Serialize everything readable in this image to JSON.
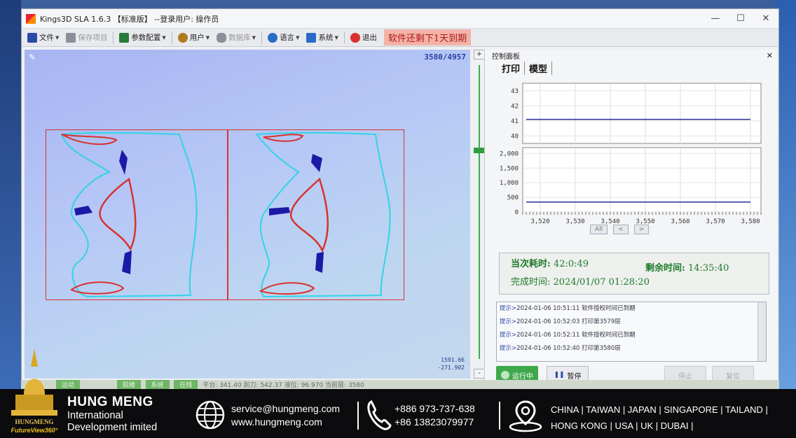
{
  "window": {
    "title": "Kings3D SLA 1.6.3 【标准版】 --登录用户: 操作员",
    "controls": [
      "—",
      "☐",
      "✕"
    ]
  },
  "toolbar": {
    "items": [
      {
        "label": "文件",
        "icon": "file-icon",
        "color": "#2a4ba8"
      },
      {
        "label": "保存项目",
        "icon": "save-icon",
        "color": "#8a8f99"
      },
      {
        "label": "参数配置",
        "icon": "settings-icon",
        "color": "#2a7a3a"
      },
      {
        "label": "用户",
        "icon": "user-icon",
        "color": "#b07a20"
      },
      {
        "label": "数据库",
        "icon": "database-icon",
        "color": "#8a8f99"
      },
      {
        "label": "语言",
        "icon": "globe-icon",
        "color": "#2a6ac8"
      },
      {
        "label": "系统",
        "icon": "system-icon",
        "color": "#2a6ac8"
      },
      {
        "label": "退出",
        "icon": "exit-icon",
        "color": "#d9322e"
      }
    ],
    "warning": "软件还剩下1天到期"
  },
  "canvas": {
    "layer_count": "3580/4957",
    "coord_x": "1591.66",
    "coord_y": "-271.902"
  },
  "panel": {
    "title": "控制面板",
    "tabs": [
      "打印",
      "模型"
    ],
    "nav": [
      "All",
      "<",
      ">"
    ],
    "stats": {
      "elapsed_label": "当次耗时:",
      "elapsed_value": "42:0:49",
      "remaining_label": "剩余时间:",
      "remaining_value": "14:35:40",
      "finish_label": "完成时间:",
      "finish_value": "2024/01/07 01:28:20"
    },
    "log": [
      {
        "prefix": "提示>",
        "time": "2024-01-06 10:51:11",
        "msg": "软件授权时间已到期"
      },
      {
        "prefix": "提示>",
        "time": "2024-01-06 10:52:03",
        "msg": "打印第3579层"
      },
      {
        "prefix": "提示>",
        "time": "2024-01-06 10:52:11",
        "msg": "软件授权时间已到期"
      },
      {
        "prefix": "提示>",
        "time": "2024-01-06 10:52:40",
        "msg": "打印第3580层"
      }
    ],
    "buttons": {
      "run": "运行中",
      "pause": "暂停",
      "stop": "停止",
      "reset": "复位"
    }
  },
  "statusbar": {
    "chips": [
      "运动",
      "",
      "",
      "就绪",
      "系统",
      "在线"
    ],
    "text": "平台: 341.40  刮刀: 542.37  液位: 96.970  当前层: 3580"
  },
  "chart_data": {
    "type": "line",
    "x": [
      3516,
      3580
    ],
    "xticks": [
      "3,520",
      "3,530",
      "3,540",
      "3,550",
      "3,560",
      "3,570",
      "3,580"
    ],
    "xlim": [
      3515,
      3583
    ],
    "upper": {
      "yticks": [
        "43",
        "42",
        "41",
        "40"
      ],
      "ylim": [
        39.5,
        43.5
      ],
      "series": [
        {
          "values": [
            41.1,
            41.1
          ],
          "color": "#2a2a9a"
        }
      ]
    },
    "lower": {
      "yticks": [
        "2,000",
        "1,500",
        "1,000",
        "500",
        "0"
      ],
      "ylim": [
        0,
        2200
      ],
      "series": [
        {
          "values": [
            340,
            340
          ],
          "color": "#2a2a9a"
        }
      ]
    }
  },
  "footer": {
    "company_name": "HUNG MENG",
    "company_line1": "International",
    "company_line2": "Development imited",
    "logo_text1": "HUNGMENG",
    "logo_text2": "FutureView360°",
    "email": "service@hungmeng.com",
    "website": "www.hungmeng.com",
    "phone1": "+886 973-737-638",
    "phone2": "+86 13823079977",
    "countries1": "CHINA | TAIWAN | JAPAN | SINGAPORE | TAILAND |",
    "countries2": "HONG KONG | USA | UK | DUBAI |"
  }
}
